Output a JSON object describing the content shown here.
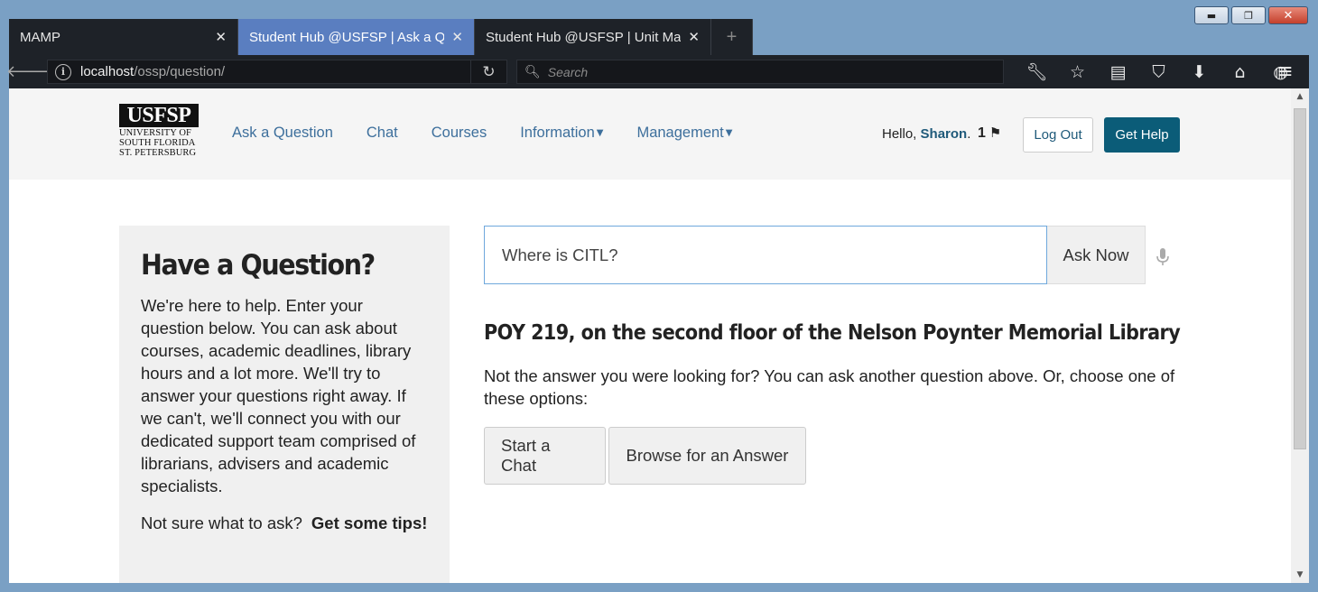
{
  "browser": {
    "tabs": [
      {
        "title": "MAMP",
        "close": "✕"
      },
      {
        "title": "Student Hub @USFSP | Ask a Question",
        "close": "✕"
      },
      {
        "title": "Student Hub @USFSP | Unit Management",
        "close": "✕"
      }
    ],
    "new_tab": "+",
    "url_host": "localhost",
    "url_path": "/ossp/question/",
    "search_placeholder": "Search",
    "window_controls": {
      "minimize": "▬",
      "maximize": "❐",
      "close": "✕"
    }
  },
  "site": {
    "logo_text": "USFSP",
    "logo_sub": [
      "UNIVERSITY OF",
      "SOUTH FLORIDA",
      "ST. PETERSBURG"
    ],
    "nav": [
      "Ask a Question",
      "Chat",
      "Courses",
      "Information",
      "Management"
    ],
    "hello_prefix": "Hello, ",
    "user": "Sharon",
    "hello_suffix": ".",
    "flag_count": "1",
    "logout": "Log Out",
    "get_help": "Get Help"
  },
  "panel": {
    "title": "Have a Question?",
    "body": "We're here to help. Enter your question below. You can ask about courses, academic deadlines, library hours and a lot more. We'll try to answer your questions right away. If we can't, we'll connect you with our dedicated support team comprised of librarians, advisers and academic specialists.",
    "tips_prefix": "Not sure what to ask?",
    "tips_link": "Get some tips!"
  },
  "question": {
    "value": "Where is CITL?",
    "ask_button": "Ask Now",
    "answer": "POY 219, on the second floor of the Nelson Poynter Memorial Library",
    "note": "Not the answer you were looking for? You can ask another question above. Or, choose one of these options:",
    "start_chat": "Start a Chat",
    "browse": "Browse for an Answer"
  }
}
